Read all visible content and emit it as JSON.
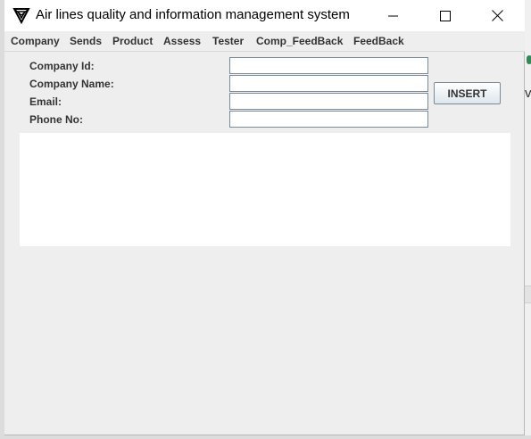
{
  "window": {
    "title": "Air lines quality and information management system",
    "app_icon": "triangle-logo-icon",
    "controls": [
      "minimize-icon",
      "maximize-icon",
      "close-icon"
    ]
  },
  "menu": {
    "items": [
      {
        "label": "Company"
      },
      {
        "label": "Sends"
      },
      {
        "label": "Product"
      },
      {
        "label": "Assess"
      },
      {
        "label": "Tester"
      },
      {
        "label": "Comp_FeedBack"
      },
      {
        "label": "FeedBack"
      }
    ]
  },
  "form": {
    "fields": [
      {
        "label": "Company Id:",
        "value": ""
      },
      {
        "label": "Company Name:",
        "value": ""
      },
      {
        "label": "Email:",
        "value": ""
      },
      {
        "label": "Phone No:",
        "value": ""
      }
    ],
    "insert_label": "INSERT"
  },
  "output": {
    "text": ""
  },
  "background": {
    "fragment_text": "va"
  },
  "colors": {
    "window_bg": "#eeeeee",
    "titlebar_bg": "#ffffff",
    "button_border": "#7a8a99"
  }
}
